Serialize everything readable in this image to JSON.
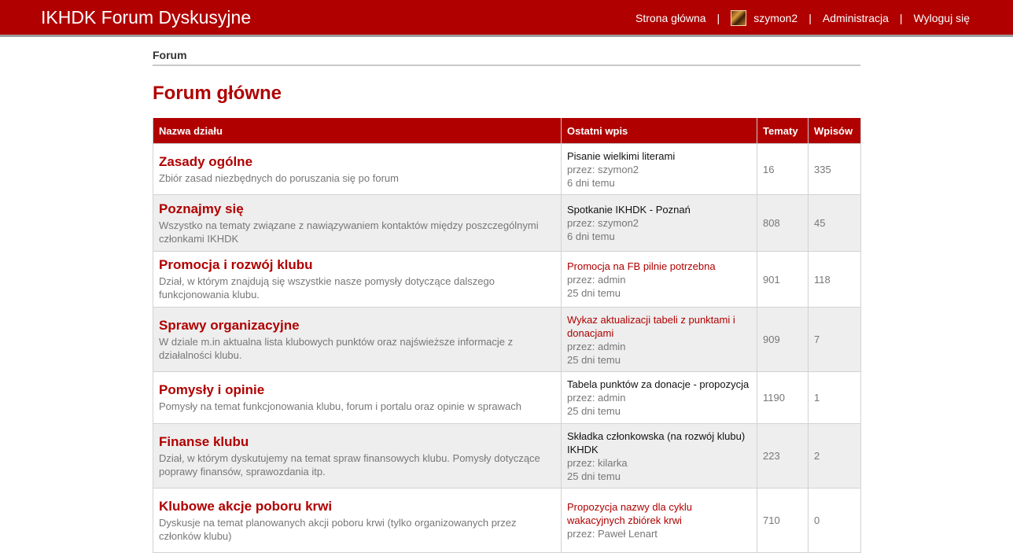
{
  "header": {
    "site_title": "IKHDK Forum Dyskusyjne",
    "nav": {
      "home": "Strona główna",
      "username": "szymon2",
      "admin": "Administracja",
      "logout": "Wyloguj się",
      "separator": "|"
    }
  },
  "breadcrumb": "Forum",
  "page_title": "Forum główne",
  "table": {
    "headers": {
      "name": "Nazwa działu",
      "last_post": "Ostatni wpis",
      "topics": "Tematy",
      "posts": "Wpisów"
    },
    "rows": [
      {
        "name": "Zasady ogólne",
        "desc": "Zbiór zasad niezbędnych do poruszania się po forum",
        "last_title": "Pisanie wielkimi literami",
        "last_by": "przez: szymon2",
        "last_when": "6 dni temu",
        "topics": "16",
        "posts": "335"
      },
      {
        "name": "Poznajmy się",
        "desc": "Wszystko na tematy związane z nawiązywaniem kontaktów między poszczególnymi członkami IKHDK",
        "last_title": "Spotkanie IKHDK - Poznań",
        "last_by": "przez: szymon2",
        "last_when": "6 dni temu",
        "topics": "808",
        "posts": "45"
      },
      {
        "name": "Promocja i rozwój klubu",
        "desc": "Dział, w którym znajdują się wszystkie nasze pomysły dotyczące dalszego funkcjonowania klubu.",
        "last_title": "Promocja na FB pilnie potrzebna",
        "last_by": "przez: admin",
        "last_when": "25 dni temu",
        "topics": "901",
        "posts": "118"
      },
      {
        "name": "Sprawy organizacyjne",
        "desc": "W dziale m.in aktualna lista klubowych punktów oraz najświeższe informacje z działalności klubu.",
        "last_title": "Wykaz aktualizacji tabeli z punktami i donacjami",
        "last_by": "przez: admin",
        "last_when": "25 dni temu",
        "topics": "909",
        "posts": "7"
      },
      {
        "name": "Pomysły i opinie",
        "desc": "Pomysły na temat funkcjonowania klubu, forum i portalu oraz opinie w sprawach",
        "last_title": "Tabela punktów za donacje - propozycja",
        "last_by": "przez: admin",
        "last_when": "25 dni temu",
        "topics": "1190",
        "posts": "1"
      },
      {
        "name": "Finanse klubu",
        "desc": "Dział, w którym dyskutujemy na temat spraw finansowych klubu. Pomysły dotyczące poprawy finansów, sprawozdania itp.",
        "last_title": "Składka członkowska (na rozwój klubu) IKHDK",
        "last_by": "przez: kilarka",
        "last_when": "25 dni temu",
        "topics": "223",
        "posts": "2"
      },
      {
        "name": "Klubowe akcje poboru krwi",
        "desc": "Dyskusje na temat planowanych akcji poboru krwi (tylko organizowanych przez członków klubu)",
        "last_title": "Propozycja nazwy dla cyklu wakacyjnych zbiórek krwi",
        "last_by": "przez: Paweł Lenart",
        "last_when": "",
        "topics": "710",
        "posts": "0"
      }
    ]
  },
  "colors": {
    "brand_red": "#b00000",
    "last_post_link_red": "#b00000",
    "last_post_link_black": "#111111"
  }
}
